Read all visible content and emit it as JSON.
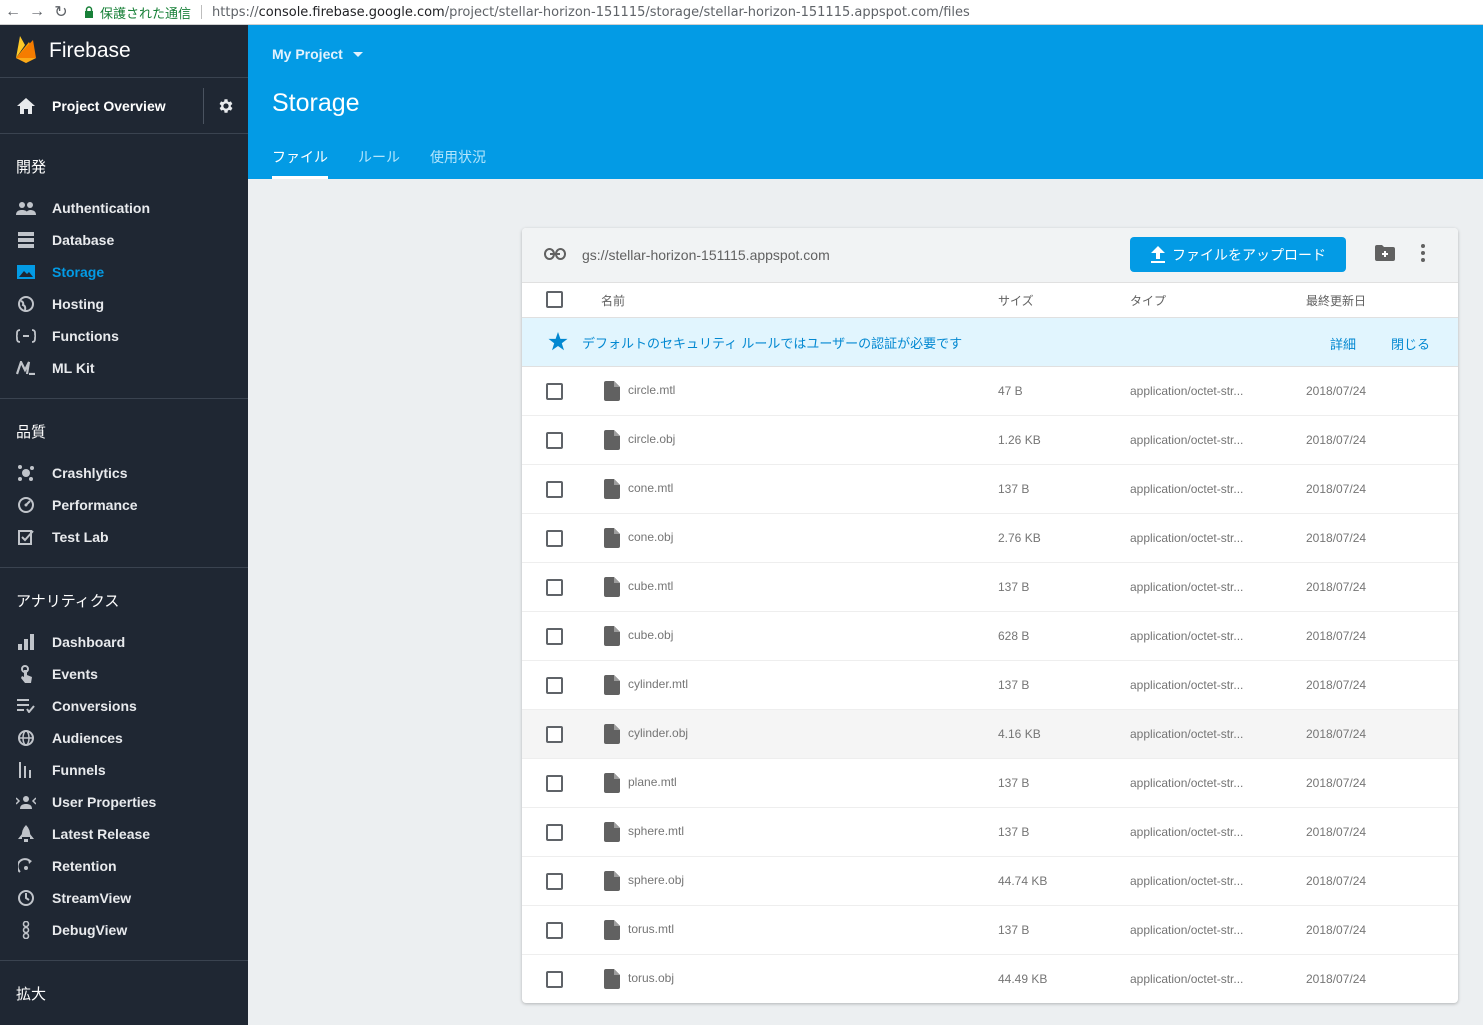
{
  "browser": {
    "secure_label": "保護された通信",
    "url_scheme": "https://",
    "url_host": "console.firebase.google.com",
    "url_path": "/project/stellar-horizon-151115/storage/stellar-horizon-151115.appspot.com/files"
  },
  "sidebar": {
    "brand": "Firebase",
    "overview": "Project Overview",
    "sections": [
      {
        "title": "開発",
        "items": [
          {
            "label": "Authentication",
            "icon": "people-icon"
          },
          {
            "label": "Database",
            "icon": "database-icon"
          },
          {
            "label": "Storage",
            "icon": "image-icon",
            "active": true
          },
          {
            "label": "Hosting",
            "icon": "globe-icon"
          },
          {
            "label": "Functions",
            "icon": "functions-icon"
          },
          {
            "label": "ML Kit",
            "icon": "ml-icon"
          }
        ]
      },
      {
        "title": "品質",
        "items": [
          {
            "label": "Crashlytics",
            "icon": "crashlytics-icon"
          },
          {
            "label": "Performance",
            "icon": "speed-icon"
          },
          {
            "label": "Test Lab",
            "icon": "testlab-icon"
          }
        ]
      },
      {
        "title": "アナリティクス",
        "items": [
          {
            "label": "Dashboard",
            "icon": "bar-chart-icon"
          },
          {
            "label": "Events",
            "icon": "touch-icon"
          },
          {
            "label": "Conversions",
            "icon": "list-check-icon"
          },
          {
            "label": "Audiences",
            "icon": "globe-icon"
          },
          {
            "label": "Funnels",
            "icon": "funnel-icon"
          },
          {
            "label": "User Properties",
            "icon": "user-props-icon"
          },
          {
            "label": "Latest Release",
            "icon": "rocket-icon"
          },
          {
            "label": "Retention",
            "icon": "retention-icon"
          },
          {
            "label": "StreamView",
            "icon": "clock-icon"
          },
          {
            "label": "DebugView",
            "icon": "debug-icon"
          }
        ]
      },
      {
        "title": "拡大",
        "items": []
      }
    ]
  },
  "header": {
    "project": "My Project",
    "title": "Storage",
    "tabs": [
      {
        "label": "ファイル",
        "active": true
      },
      {
        "label": "ルール"
      },
      {
        "label": "使用状況"
      }
    ]
  },
  "storage": {
    "bucket": "gs://stellar-horizon-151115.appspot.com",
    "upload_label": "ファイルをアップロード",
    "columns": {
      "name": "名前",
      "size": "サイズ",
      "type": "タイプ",
      "modified": "最終更新日"
    },
    "banner": {
      "message": "デフォルトのセキュリティ ルールではユーザーの認証が必要です",
      "details": "詳細",
      "close": "閉じる"
    },
    "files": [
      {
        "name": "circle.mtl",
        "size": "47 B",
        "type": "application/octet-str...",
        "date": "2018/07/24"
      },
      {
        "name": "circle.obj",
        "size": "1.26 KB",
        "type": "application/octet-str...",
        "date": "2018/07/24"
      },
      {
        "name": "cone.mtl",
        "size": "137 B",
        "type": "application/octet-str...",
        "date": "2018/07/24"
      },
      {
        "name": "cone.obj",
        "size": "2.76 KB",
        "type": "application/octet-str...",
        "date": "2018/07/24"
      },
      {
        "name": "cube.mtl",
        "size": "137 B",
        "type": "application/octet-str...",
        "date": "2018/07/24"
      },
      {
        "name": "cube.obj",
        "size": "628 B",
        "type": "application/octet-str...",
        "date": "2018/07/24"
      },
      {
        "name": "cylinder.mtl",
        "size": "137 B",
        "type": "application/octet-str...",
        "date": "2018/07/24"
      },
      {
        "name": "cylinder.obj",
        "size": "4.16 KB",
        "type": "application/octet-str...",
        "date": "2018/07/24",
        "hover": true
      },
      {
        "name": "plane.mtl",
        "size": "137 B",
        "type": "application/octet-str...",
        "date": "2018/07/24"
      },
      {
        "name": "sphere.mtl",
        "size": "137 B",
        "type": "application/octet-str...",
        "date": "2018/07/24"
      },
      {
        "name": "sphere.obj",
        "size": "44.74 KB",
        "type": "application/octet-str...",
        "date": "2018/07/24"
      },
      {
        "name": "torus.mtl",
        "size": "137 B",
        "type": "application/octet-str...",
        "date": "2018/07/24"
      },
      {
        "name": "torus.obj",
        "size": "44.49 KB",
        "type": "application/octet-str...",
        "date": "2018/07/24"
      }
    ]
  },
  "colors": {
    "sidebar_bg": "#1f2733",
    "header_bg": "#039be5",
    "accent": "#039be5",
    "banner_bg": "#e1f5fe"
  }
}
